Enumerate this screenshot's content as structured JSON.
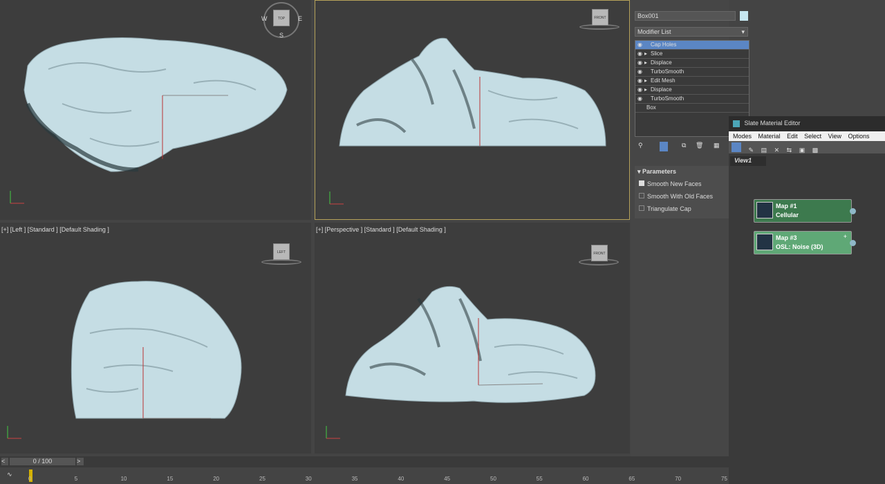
{
  "viewports": {
    "top": {
      "label": "",
      "cube": "TOP",
      "compass": {
        "n": "W",
        "e": "E",
        "s": "S"
      }
    },
    "front": {
      "label": "",
      "cube": "FRONT"
    },
    "left": {
      "label": "[+] [Left ] [Standard ] [Default Shading ]",
      "cube": "LEFT"
    },
    "perspective": {
      "label": "[+] [Perspective ] [Standard ] [Default Shading ]",
      "cube": "FRONT"
    }
  },
  "command_panel": {
    "object_name": "Box001",
    "modifier_list": "Modifier List",
    "stack": [
      "Cap Holes",
      "Slice",
      "Displace",
      "TurboSmooth",
      "Edit Mesh",
      "Displace",
      "TurboSmooth",
      "Box"
    ],
    "parameters_title": "Parameters",
    "params": [
      {
        "label": "Smooth New Faces",
        "checked": true
      },
      {
        "label": "Smooth With Old Faces",
        "checked": false
      },
      {
        "label": "Triangulate Cap",
        "checked": false
      }
    ]
  },
  "slate": {
    "title": "Slate Material Editor",
    "menu": [
      "Modes",
      "Material",
      "Edit",
      "Select",
      "View",
      "Options"
    ],
    "tab": "View1",
    "nodes": [
      {
        "title": "Map #1",
        "subtitle": "Cellular",
        "color": "#3d7a4e"
      },
      {
        "title": "Map #3",
        "subtitle": "OSL: Noise (3D)",
        "color": "#5fa876"
      }
    ]
  },
  "timeline": {
    "frame": "0 / 100",
    "prev": "<",
    "next": ">",
    "ticks": [
      "0",
      "5",
      "10",
      "15",
      "20",
      "25",
      "30",
      "35",
      "40",
      "45",
      "50",
      "55",
      "60",
      "65",
      "70",
      "75"
    ]
  }
}
